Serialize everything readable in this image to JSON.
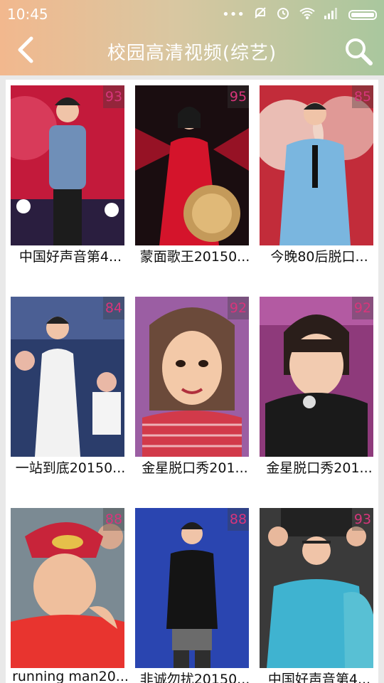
{
  "status_bar": {
    "time": "10:45",
    "icons": [
      "dots-icon",
      "mute-icon",
      "alarm-icon",
      "wifi-icon",
      "signal-icon",
      "battery-icon"
    ]
  },
  "app_bar": {
    "title": "校园高清视频(综艺)",
    "back_icon": "chevron-left-icon",
    "search_icon": "search-icon"
  },
  "colors": {
    "score_text": "#d8357b",
    "topbar_gradient": [
      "#f2b88e",
      "#a9c79e"
    ]
  },
  "videos": [
    {
      "title": "中国好声音第4...",
      "score": "93"
    },
    {
      "title": "蒙面歌王20150...",
      "score": "95"
    },
    {
      "title": "今晚80后脱口...",
      "score": "85"
    },
    {
      "title": "一站到底20150...",
      "score": "84"
    },
    {
      "title": "金星脱口秀201...",
      "score": "92"
    },
    {
      "title": "金星脱口秀201...",
      "score": "92"
    },
    {
      "title": "running man20...",
      "score": "88"
    },
    {
      "title": "非诚勿扰20150...",
      "score": "88"
    },
    {
      "title": "中国好声音第4...",
      "score": "93"
    }
  ]
}
